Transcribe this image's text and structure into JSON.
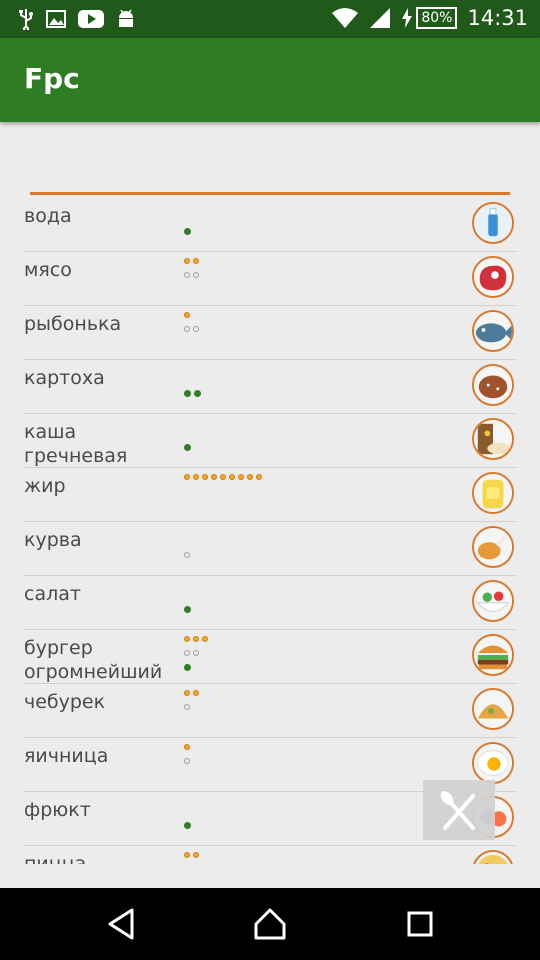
{
  "status": {
    "battery": "80%",
    "time": "14:31"
  },
  "app": {
    "title": "Fpc"
  },
  "foods": [
    {
      "name": "вода",
      "icon": "water-bottle-icon",
      "dots": [
        [],
        [
          "g"
        ]
      ]
    },
    {
      "name": "мясо",
      "icon": "steak-icon",
      "dots": [
        [
          "o",
          "o"
        ],
        [
          "w",
          "w"
        ]
      ]
    },
    {
      "name": "рыбонька",
      "icon": "fish-icon",
      "dots": [
        [
          "o"
        ],
        [
          "w",
          "w"
        ]
      ]
    },
    {
      "name": "картоха",
      "icon": "potato-icon",
      "dots": [
        [],
        [
          "g",
          "g"
        ]
      ]
    },
    {
      "name": "каша\nгречневая",
      "icon": "porridge-icon",
      "dots": [
        [],
        [
          "g"
        ]
      ]
    },
    {
      "name": "жир",
      "icon": "fat-jar-icon",
      "dots": [
        [
          "o",
          "o",
          "o",
          "o",
          "o",
          "o",
          "o",
          "o",
          "o"
        ]
      ]
    },
    {
      "name": "курва",
      "icon": "chicken-leg-icon",
      "dots": [
        [],
        [
          "w"
        ]
      ]
    },
    {
      "name": "салат",
      "icon": "salad-icon",
      "dots": [
        [],
        [],
        [
          "g"
        ]
      ]
    },
    {
      "name": "бургер\nогромнейший",
      "icon": "burger-icon",
      "dots": [
        [
          "o",
          "o",
          "o"
        ],
        [
          "w",
          "w"
        ],
        [
          "g"
        ]
      ]
    },
    {
      "name": "чебурек",
      "icon": "pastry-icon",
      "dots": [
        [
          "o",
          "o"
        ],
        [
          "w"
        ]
      ]
    },
    {
      "name": "яичница",
      "icon": "fried-egg-icon",
      "dots": [
        [
          "o"
        ],
        [
          "w"
        ]
      ]
    },
    {
      "name": "фрюкт",
      "icon": "fruit-icon",
      "dots": [
        [],
        [],
        [
          "g"
        ]
      ]
    },
    {
      "name": "пицца",
      "icon": "pizza-icon",
      "dots": [
        [
          "o",
          "o"
        ]
      ]
    }
  ],
  "colors": {
    "appbar": "#2E7D24",
    "statusbar": "#20591A",
    "accent": "#D9782A"
  }
}
